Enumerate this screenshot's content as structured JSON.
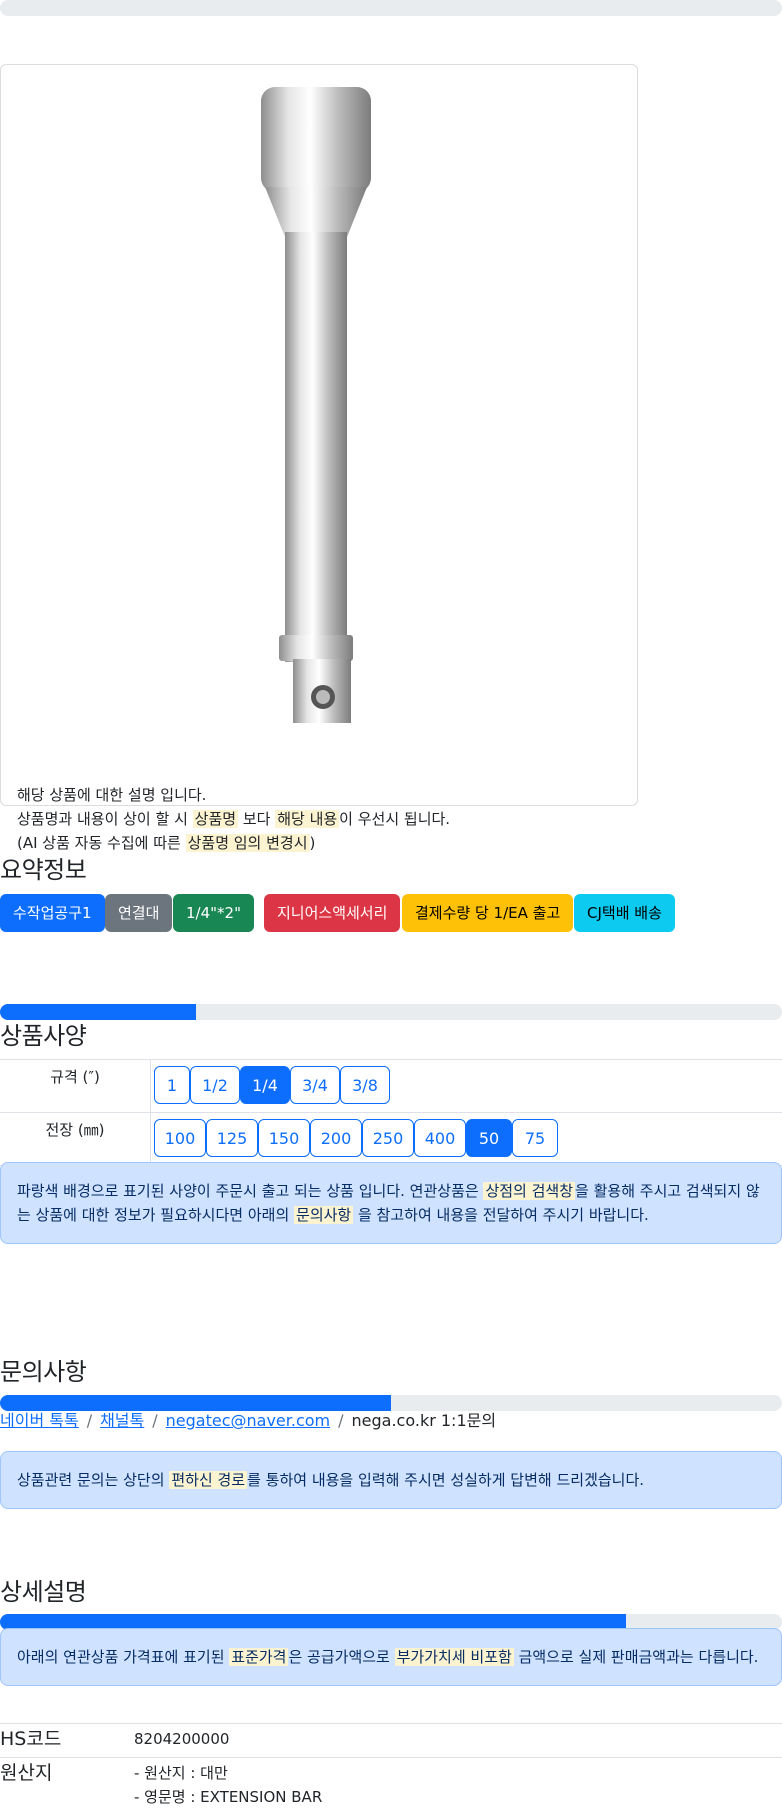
{
  "top_progress": {
    "percent": 0
  },
  "product": {
    "image_alt": "extension bar",
    "description": {
      "line1": "해당 상품에 대한 설명 입니다.",
      "line2_pre": "상품명과 내용이 상이 할 시 ",
      "line2_mark1": "상품명",
      "line2_mid": " 보다 ",
      "line2_mark2": "해당 내용",
      "line2_post": "이 우선시 됩니다.",
      "line3_pre": "(AI 상품 자동 수집에 따른 ",
      "line3_mark": "상품명 임의 변경시",
      "line3_post": ")"
    }
  },
  "summary": {
    "title": "요약정보",
    "badges": [
      {
        "label": "수작업공구1",
        "color": "#0d6efd"
      },
      {
        "label": "연결대",
        "color": "#6c757d"
      },
      {
        "label": "1/4\"*2\"",
        "color": "#198754"
      },
      {
        "label": "지니어스액세서리",
        "color": "#dc3545"
      },
      {
        "label": "결제수량 당 1/EA 출고",
        "color": "#ffc107"
      },
      {
        "label": "CJ택배 배송",
        "color": "#0dcaf0"
      }
    ]
  },
  "spec": {
    "progress_percent": 25,
    "title": "상품사양",
    "rows": [
      {
        "label": "규격 (″)",
        "options": [
          "1",
          "1/2",
          "1/4",
          "3/4",
          "3/8"
        ],
        "selected": "1/4"
      },
      {
        "label": "전장 (㎜)",
        "options": [
          "100",
          "125",
          "150",
          "200",
          "250",
          "400",
          "50",
          "75"
        ],
        "selected": "50"
      }
    ],
    "notice": {
      "p1": "파랑색 배경으로 표기된 사양이 주문시 출고 되는 상품 입니다. 연관상품은 ",
      "m1": "상점의 검색창",
      "p2": "을 활용해 주시고 검색되지 않",
      "p3": "는 상품에 대한 정보가 필요하시다면 아래의 ",
      "m2": "문의사항",
      "p4": " 을 참고하여 내용을 전달하여 주시기 바랍니다."
    }
  },
  "inquiry": {
    "title": "문의사항",
    "progress_percent": 50,
    "links": [
      "네이버 톡톡",
      "채널톡",
      "negatec@naver.com"
    ],
    "plain": "nega.co.kr 1:1문의",
    "notice": {
      "p1": "상품관련 문의는 상단의 ",
      "m1": "편하신 경로",
      "p2": "를 통하여 내용을 입력해 주시면 성실하게 답변해 드리겠습니다."
    }
  },
  "detail": {
    "title": "상세설명",
    "progress_percent": 80,
    "notice": {
      "p1": "아래의 연관상품 가격표에 표기된 ",
      "m1": "표준가격",
      "p2": "은 공급가액으로 ",
      "m2": "부가가치세 비포함",
      "p3": " 금액으로 실제 판매금액과는 다릅니다."
    },
    "hs_label": "HS코드",
    "hs_value": "8204200000",
    "origin_label": "원산지",
    "origin_line1": "- 원산지 : 대만",
    "origin_line2": "- 영문명 : EXTENSION BAR"
  }
}
